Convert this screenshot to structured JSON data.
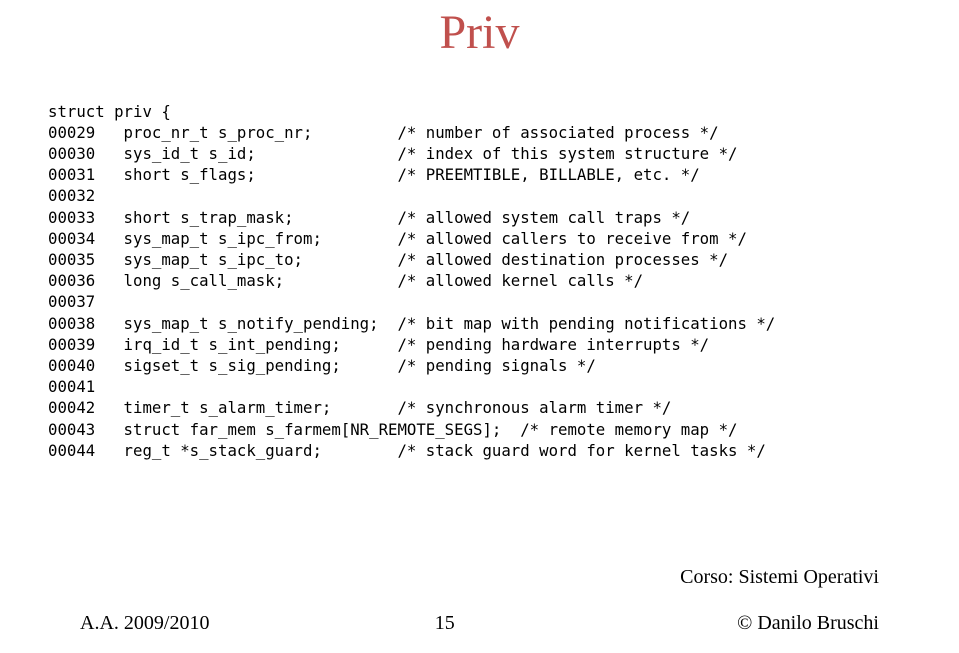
{
  "title": "Priv",
  "code_lines": [
    "struct priv {",
    "00029   proc_nr_t s_proc_nr;         /* number of associated process */",
    "00030   sys_id_t s_id;               /* index of this system structure */",
    "00031   short s_flags;               /* PREEMTIBLE, BILLABLE, etc. */",
    "00032",
    "00033   short s_trap_mask;           /* allowed system call traps */",
    "00034   sys_map_t s_ipc_from;        /* allowed callers to receive from */",
    "00035   sys_map_t s_ipc_to;          /* allowed destination processes */",
    "00036   long s_call_mask;            /* allowed kernel calls */",
    "00037",
    "00038   sys_map_t s_notify_pending;  /* bit map with pending notifications */",
    "00039   irq_id_t s_int_pending;      /* pending hardware interrupts */",
    "00040   sigset_t s_sig_pending;      /* pending signals */",
    "00041",
    "00042   timer_t s_alarm_timer;       /* synchronous alarm timer */",
    "00043   struct far_mem s_farmem[NR_REMOTE_SEGS];  /* remote memory map */",
    "00044   reg_t *s_stack_guard;        /* stack guard word for kernel tasks */"
  ],
  "footer": {
    "left": "A.A. 2009/2010",
    "center": "15",
    "right_line1": "Corso: Sistemi Operativi",
    "right_line2": "© Danilo Bruschi"
  }
}
